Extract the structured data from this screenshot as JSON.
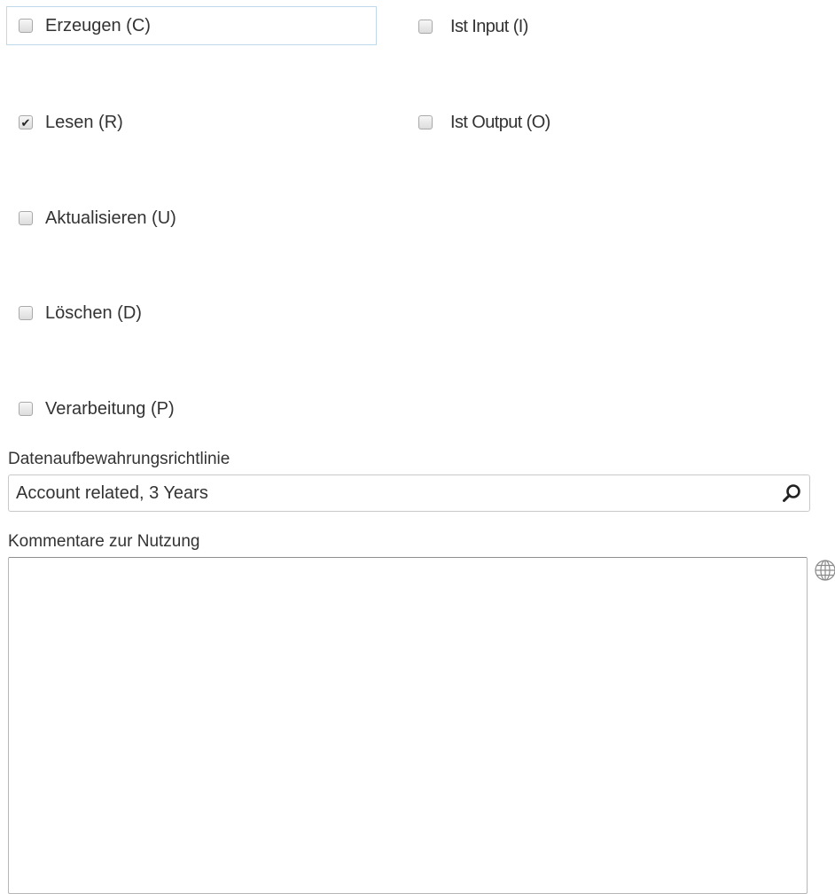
{
  "checkboxes": {
    "create": {
      "label": "Erzeugen (C)",
      "checked": false
    },
    "read": {
      "label": "Lesen (R)",
      "checked": true
    },
    "update": {
      "label": "Aktualisieren (U)",
      "checked": false
    },
    "delete": {
      "label": "Löschen (D)",
      "checked": false
    },
    "process": {
      "label": "Verarbeitung (P)",
      "checked": false
    },
    "is_input": {
      "label": "Ist Input (I)",
      "checked": false
    },
    "is_output": {
      "label": "Ist Output (O)",
      "checked": false
    }
  },
  "retention": {
    "label": "Datenaufbewahrungsrichtlinie",
    "value": "Account related, 3 Years",
    "search_icon": "search-icon"
  },
  "comments": {
    "label": "Kommentare zur Nutzung",
    "value": "",
    "translate_icon": "globe-icon"
  },
  "colors": {
    "focus_border": "#bfd8ea",
    "text": "#333333",
    "border": "#c8c8c8"
  }
}
